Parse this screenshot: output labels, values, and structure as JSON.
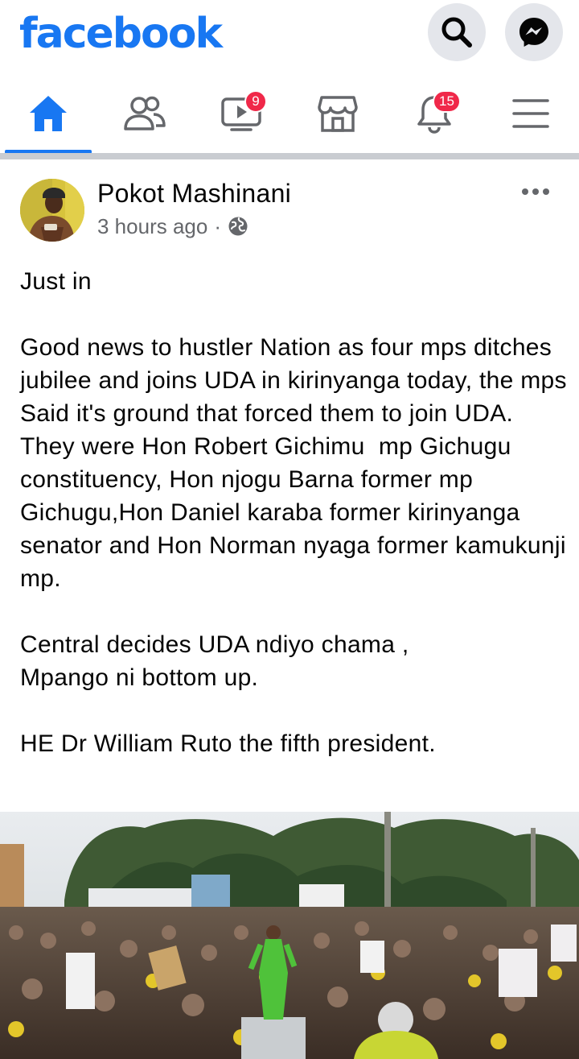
{
  "app": {
    "logo_text": "facebook",
    "brand_color": "#1877f2"
  },
  "topbar": {
    "search_icon": "search-icon",
    "messenger_icon": "messenger-icon"
  },
  "tabs": [
    {
      "name": "home",
      "icon": "home-icon",
      "active": true,
      "badge": ""
    },
    {
      "name": "friends",
      "icon": "friends-icon",
      "active": false,
      "badge": ""
    },
    {
      "name": "watch",
      "icon": "watch-icon",
      "active": false,
      "badge": "9"
    },
    {
      "name": "marketplace",
      "icon": "marketplace-icon",
      "active": false,
      "badge": ""
    },
    {
      "name": "notifications",
      "icon": "bell-icon",
      "active": false,
      "badge": "15"
    },
    {
      "name": "menu",
      "icon": "hamburger-icon",
      "active": false,
      "badge": ""
    }
  ],
  "post": {
    "author": "Pokot Mashinani",
    "time": "3 hours ago",
    "separator": "·",
    "audience_icon": "globe-icon",
    "more_icon": "more-options-icon",
    "text": "Just in\n\nGood news to hustler Nation as four mps ditches jubilee and joins UDA in kirinyanga today, the mps Said it's ground that forced them to join UDA.\nThey were Hon Robert Gichimu  mp Gichugu constituency, Hon njogu Barna former mp Gichugu,Hon Daniel karaba former kirinyanga senator and Hon Norman nyaga former kamukunji mp.\n\nCentral decides UDA ndiyo chama ,\nMpango ni bottom up.\n\nHE Dr William Ruto the fifth president."
  }
}
